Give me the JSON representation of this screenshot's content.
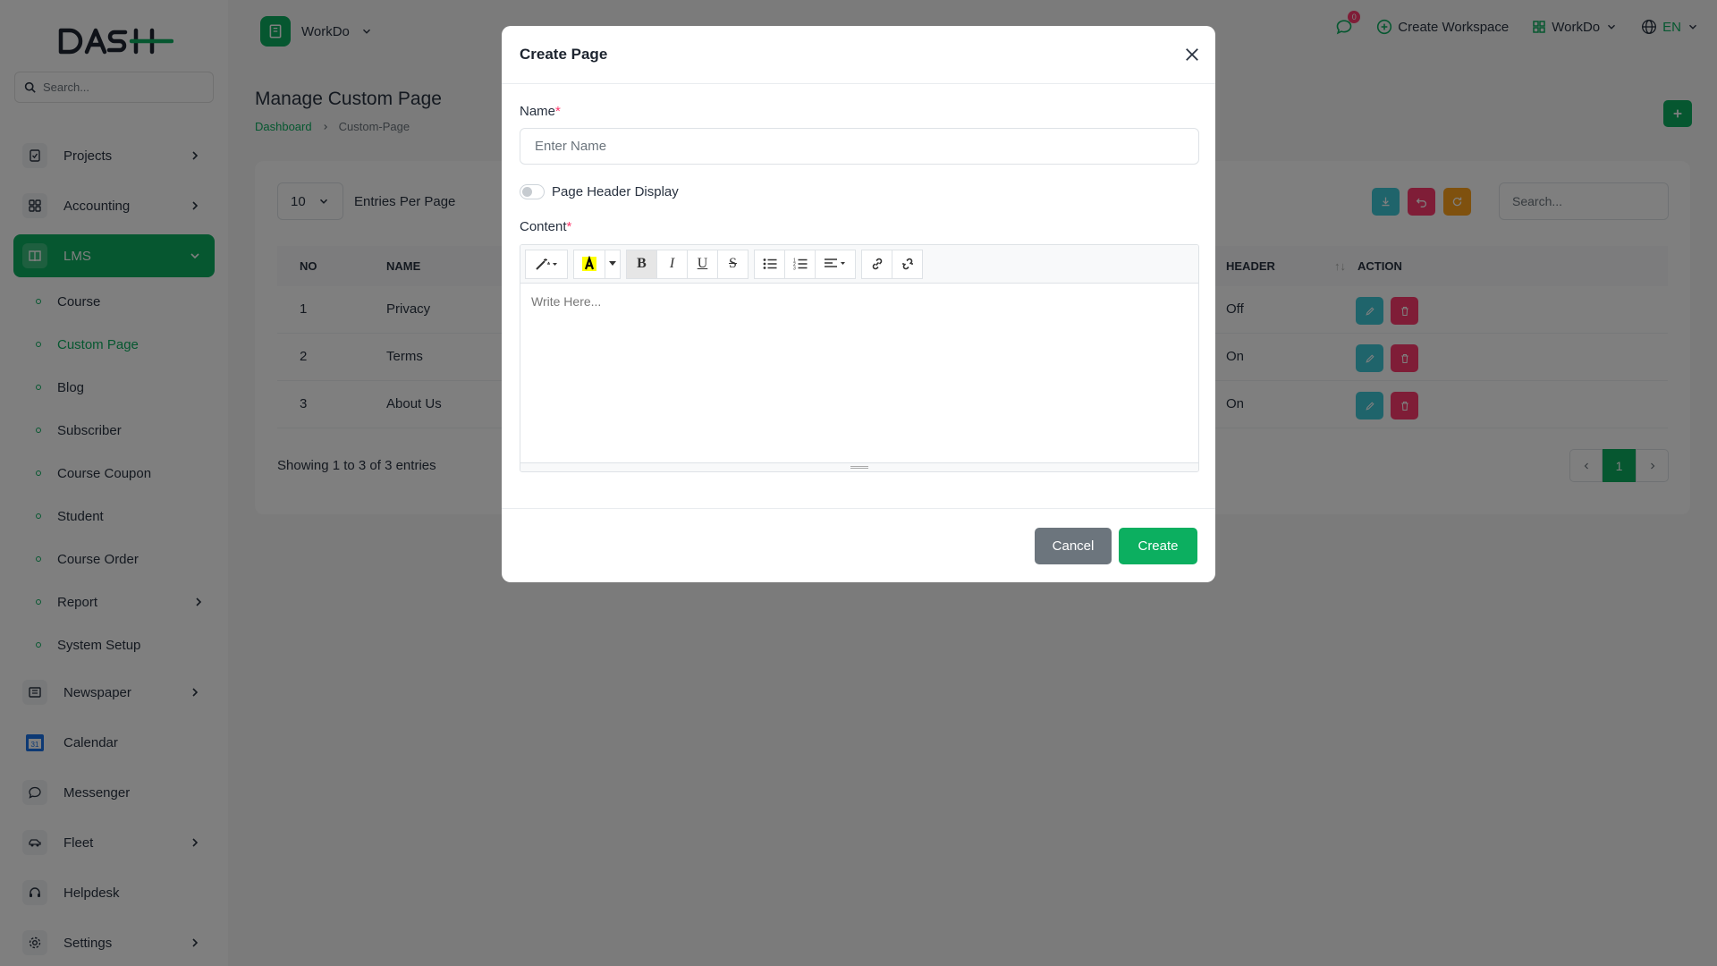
{
  "sidebar": {
    "logo_text": "DASH",
    "search_placeholder": "Search...",
    "items": [
      {
        "label": "Projects",
        "icon": "clipboard-check-icon",
        "chevron": true
      },
      {
        "label": "Accounting",
        "icon": "grid-icon",
        "chevron": true
      },
      {
        "label": "LMS",
        "icon": "book-icon",
        "chevron": true,
        "active": true
      },
      {
        "label": "Newspaper",
        "icon": "newspaper-icon",
        "chevron": true
      },
      {
        "label": "Calendar",
        "icon": "calendar-icon",
        "chevron": false
      },
      {
        "label": "Messenger",
        "icon": "chat-icon",
        "chevron": false
      },
      {
        "label": "Fleet",
        "icon": "car-icon",
        "chevron": true
      },
      {
        "label": "Helpdesk",
        "icon": "headset-icon",
        "chevron": false
      },
      {
        "label": "Settings",
        "icon": "gear-icon",
        "chevron": true
      }
    ],
    "lms_sub": [
      {
        "label": "Course"
      },
      {
        "label": "Custom Page",
        "active": true
      },
      {
        "label": "Blog"
      },
      {
        "label": "Subscriber"
      },
      {
        "label": "Course Coupon"
      },
      {
        "label": "Student"
      },
      {
        "label": "Course Order"
      },
      {
        "label": "Report",
        "chevron": true
      },
      {
        "label": "System Setup"
      }
    ]
  },
  "topbar": {
    "workspace": "WorkDo",
    "notification_count": "0",
    "create_workspace": "Create Workspace",
    "workspace_switch": "WorkDo",
    "language": "EN"
  },
  "page": {
    "title": "Manage Custom Page",
    "breadcrumb": [
      "Dashboard",
      "Custom-Page"
    ]
  },
  "table": {
    "entries_value": "10",
    "entries_label": "Entries Per Page",
    "search_placeholder": "Search...",
    "columns": [
      "NO",
      "NAME",
      "HEADER",
      "ACTION"
    ],
    "rows": [
      {
        "no": "1",
        "name": "Privacy",
        "header": "Off"
      },
      {
        "no": "2",
        "name": "Terms",
        "header": "On"
      },
      {
        "no": "3",
        "name": "About Us",
        "header": "On"
      }
    ],
    "showing": "Showing 1 to 3 of 3 entries",
    "current_page": "1"
  },
  "modal": {
    "title": "Create Page",
    "name_label": "Name",
    "name_placeholder": "Enter Name",
    "required_mark": "*",
    "toggle_label": "Page Header Display",
    "toggle_on": false,
    "content_label": "Content",
    "editor_placeholder": "Write Here...",
    "cancel": "Cancel",
    "create": "Create"
  },
  "colors": {
    "primary": "#0caf60",
    "info": "#3ec9d6",
    "danger": "#ff3a6e",
    "warning": "#ffa21d",
    "secondary": "#6c757d"
  }
}
